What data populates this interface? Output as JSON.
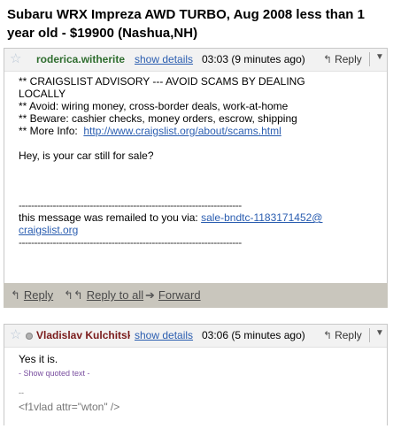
{
  "subject": "Subaru WRX Impreza AWD TURBO, Aug 2008 less than 1 year old - $19900 (Nashua,NH)",
  "messages": [
    {
      "sender": "roderica.witherite",
      "show_details": "show details",
      "time": "03:03 (9 minutes ago)",
      "reply": "Reply",
      "body": {
        "line1": "** CRAIGSLIST ADVISORY --- AVOID SCAMS BY DEALING",
        "line2": "LOCALLY",
        "line3": "** Avoid:  wiring money, cross-border deals, work-at-home",
        "line4": "** Beware: cashier checks, money orders, escrow, shipping",
        "line5_prefix": "** More Info:  ",
        "line5_link": "http://www.craigslist.org/about/scams.html",
        "question": "Hey, is your car still for sale?",
        "dashes": "------------------------------------------------------------------------",
        "remail_prefix": "this message was remailed to you via: ",
        "remail_link1": "sale-bndtc-1183171452@",
        "remail_link2": "craigslist.org"
      }
    },
    {
      "sender": "Vladislav Kulchitski",
      "show_details": "show details",
      "time": "03:06 (5 minutes ago)",
      "reply": "Reply",
      "body": {
        "text": "Yes it is.",
        "show_quoted": "- Show quoted text -",
        "sig_dash": "--",
        "sig": "<f1vlad attr=\"wton\" />"
      }
    }
  ],
  "actions": {
    "reply": "Reply",
    "reply_all": "Reply to all",
    "forward": "Forward"
  }
}
